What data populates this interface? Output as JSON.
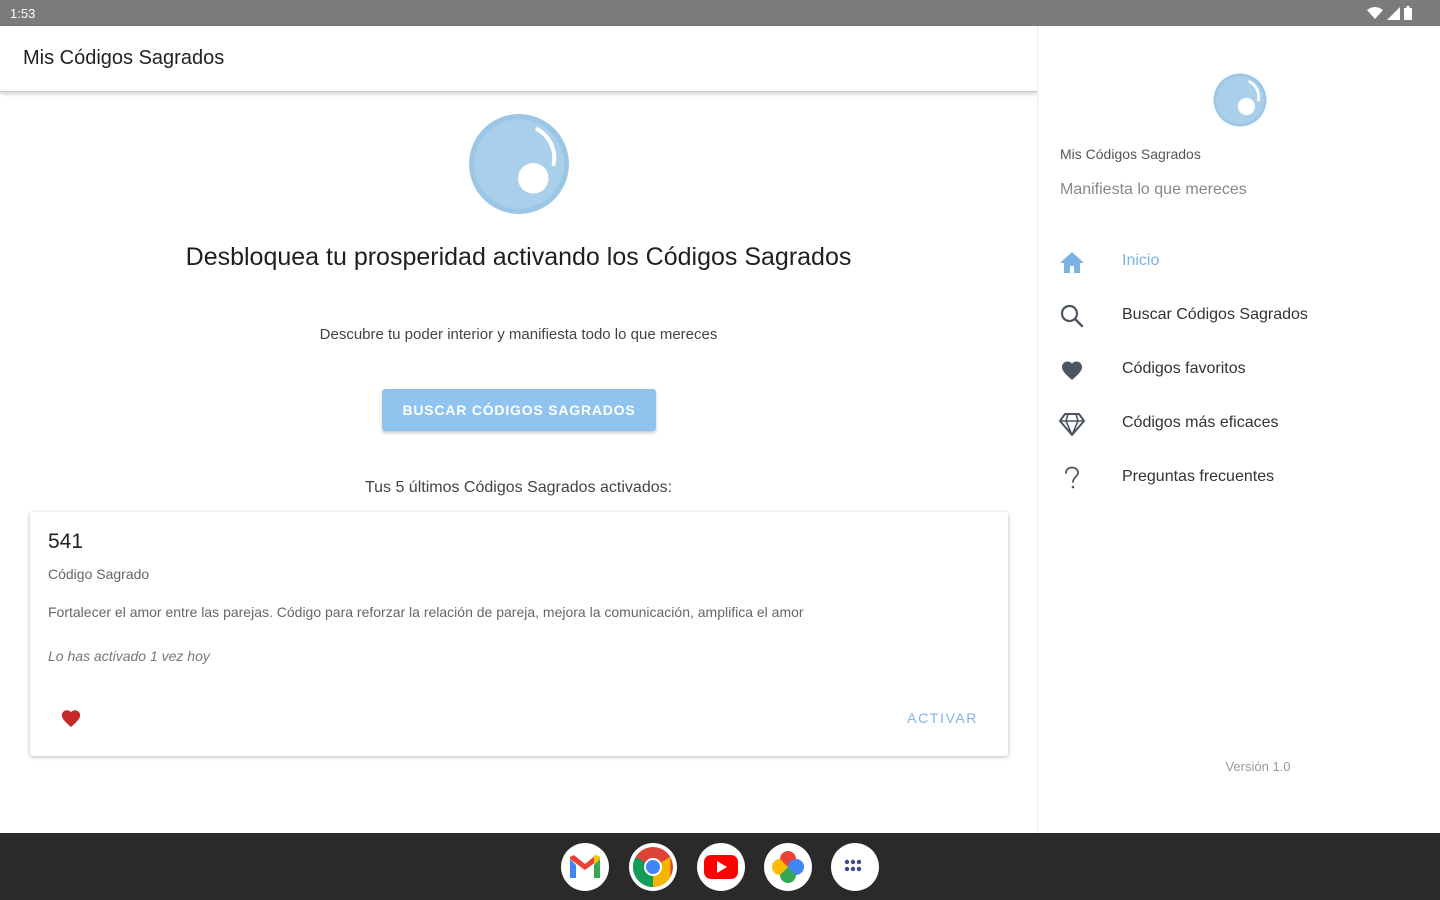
{
  "status_bar": {
    "time": "1:53"
  },
  "app_bar": {
    "title": "Mis Códigos Sagrados"
  },
  "main": {
    "headline": "Desbloquea tu prosperidad activando los Códigos Sagrados",
    "subline": "Descubre tu poder interior y manifiesta todo lo que mereces",
    "search_button_label": "BUSCAR CÓDIGOS SAGRADOS",
    "recent_label": "Tus 5 últimos Códigos Sagrados activados:"
  },
  "card": {
    "number": "541",
    "type": "Código Sagrado",
    "description": "Fortalecer el amor entre las parejas. Código para reforzar la relación de pareja, mejora la comunicación, amplifica el amor",
    "activated_text": "Lo has activado 1 vez hoy",
    "activate_label": "ACTIVAR",
    "favorite": true
  },
  "drawer": {
    "app_name": "Mis Códigos Sagrados",
    "tagline": "Manifiesta lo que mereces",
    "items": [
      {
        "label": "Inicio",
        "icon": "home-icon",
        "active": true
      },
      {
        "label": "Buscar Códigos Sagrados",
        "icon": "search-icon",
        "active": false
      },
      {
        "label": "Códigos favoritos",
        "icon": "heart-icon",
        "active": false
      },
      {
        "label": "Códigos más eficaces",
        "icon": "diamond-icon",
        "active": false
      },
      {
        "label": "Preguntas frecuentes",
        "icon": "question-icon",
        "active": false
      }
    ],
    "version": "Versión 1.0"
  },
  "dock": {
    "apps": [
      {
        "name": "gmail-icon"
      },
      {
        "name": "chrome-icon"
      },
      {
        "name": "youtube-icon"
      },
      {
        "name": "photos-icon"
      },
      {
        "name": "app-drawer-icon"
      }
    ]
  },
  "colors": {
    "accent": "#7ab3e6",
    "button": "#90c4ee",
    "heart": "#c62828",
    "icon_dark": "#4b5563"
  }
}
